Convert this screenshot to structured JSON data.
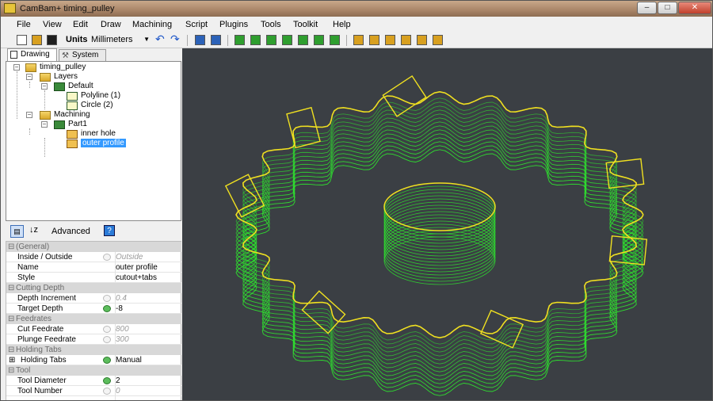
{
  "window": {
    "title": "CamBam+  timing_pulley",
    "controls": [
      "–",
      "□",
      "✕"
    ]
  },
  "menu": [
    "File",
    "View",
    "Edit",
    "Draw",
    "Machining",
    "Script",
    "Plugins",
    "Tools",
    "Toolkit",
    "Help"
  ],
  "toolbar": {
    "units_label": "Units",
    "units_value": "Millimeters"
  },
  "tabs": {
    "drawing": "Drawing",
    "system": "System"
  },
  "tree": {
    "root": "timing_pulley",
    "layers": "Layers",
    "default_layer": "Default",
    "polyline": "Polyline (1)",
    "circle": "Circle (2)",
    "machining": "Machining",
    "part": "Part1",
    "op1": "inner hole",
    "op2": "outer profile"
  },
  "prop_toolbar": {
    "advanced": "Advanced",
    "help": "?"
  },
  "properties": {
    "general": "(General)",
    "inside_outside": {
      "name": "Inside / Outside",
      "value": "Outside"
    },
    "name": {
      "name": "Name",
      "value": "outer profile"
    },
    "style": {
      "name": "Style",
      "value": "cutout+tabs"
    },
    "cutting_depth": "Cutting Depth",
    "depth_increment": {
      "name": "Depth Increment",
      "value": "0.4"
    },
    "target_depth": {
      "name": "Target Depth",
      "value": "-8"
    },
    "feedrates": "Feedrates",
    "cut_feedrate": {
      "name": "Cut Feedrate",
      "value": "800"
    },
    "plunge_feedrate": {
      "name": "Plunge Feedrate",
      "value": "300"
    },
    "holding_tabs": "Holding Tabs",
    "holding_tabs_row": {
      "name": "Holding Tabs",
      "value": "Manual"
    },
    "tool": "Tool",
    "tool_diameter": {
      "name": "Tool Diameter",
      "value": "2"
    },
    "tool_number": {
      "name": "Tool Number",
      "value": "0"
    }
  },
  "colors": {
    "toolpath": "#2ee82e",
    "outline": "#f0e020",
    "background": "#3b3f44",
    "selection": "#3399ff"
  }
}
